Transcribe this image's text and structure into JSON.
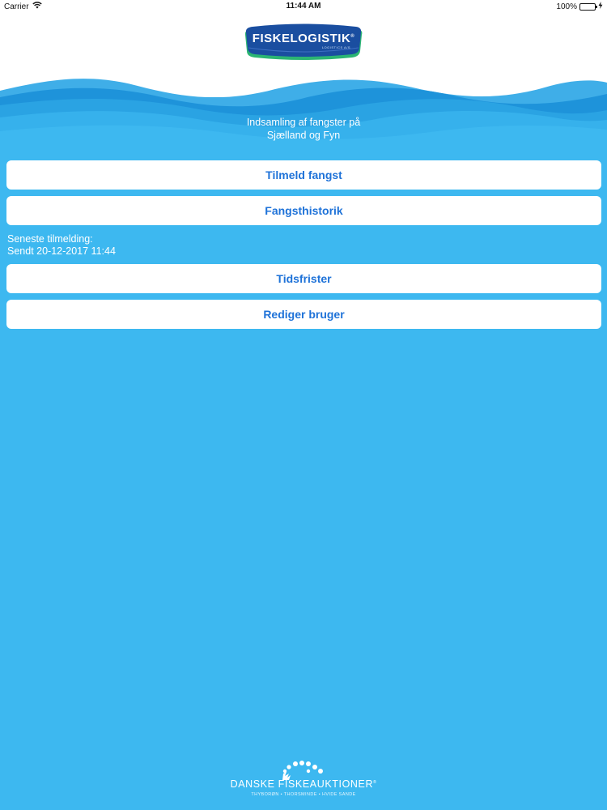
{
  "status_bar": {
    "carrier": "Carrier",
    "time": "11:44 AM",
    "battery": "100%",
    "battery_level": 1.0
  },
  "header": {
    "logo_text": "FISKELOGISTIK",
    "logo_registered": "®",
    "logo_subtext": "LOGISTICS A/S"
  },
  "subtitle": {
    "line1": "Indsamling af fangster på",
    "line2": "Sjælland og Fyn"
  },
  "buttons": {
    "register_catch": "Tilmeld fangst",
    "catch_history": "Fangsthistorik",
    "deadlines": "Tidsfrister",
    "edit_user": "Rediger bruger"
  },
  "latest": {
    "label": "Seneste tilmelding:",
    "value": "Sendt 20-12-2017 11:44"
  },
  "footer": {
    "brand": "DANSKE FISKEAUKTIONER",
    "registered": "®",
    "towns": "THYBORØN • THORSMINDE • HVIDE SANDE"
  },
  "colors": {
    "background": "#3db8f0",
    "button_text": "#1e72d8",
    "logo_blue": "#1a4ea0",
    "logo_green": "#2bb573"
  }
}
